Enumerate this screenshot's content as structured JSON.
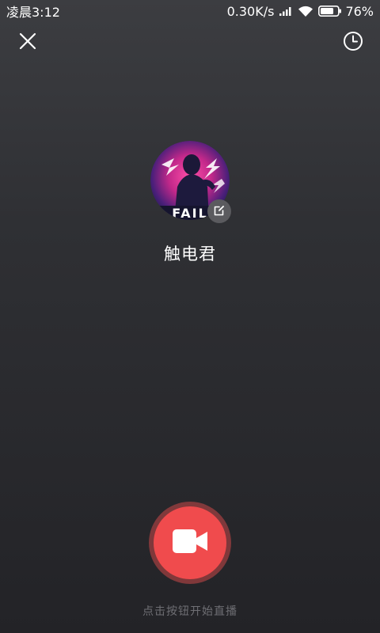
{
  "status_bar": {
    "time": "凌晨3:12",
    "network_speed": "0.30K/s",
    "battery": "76%",
    "battery_level": 0.76,
    "signal_icon": "signal-icon",
    "wifi_icon": "wifi-icon",
    "battery_icon": "battery-icon"
  },
  "toolbar": {
    "close_icon": "close-icon",
    "history_icon": "clock-icon"
  },
  "profile": {
    "username": "触电君",
    "avatar_icon": "avatar-image",
    "edit_icon": "edit-icon"
  },
  "record": {
    "icon": "video-camera-icon",
    "hint": "点击按钮开始直播"
  },
  "colors": {
    "accent": "#f04b4d",
    "background_top": "#3c3d41",
    "background_bottom": "#232327",
    "hint_text": "#6f6f74"
  }
}
